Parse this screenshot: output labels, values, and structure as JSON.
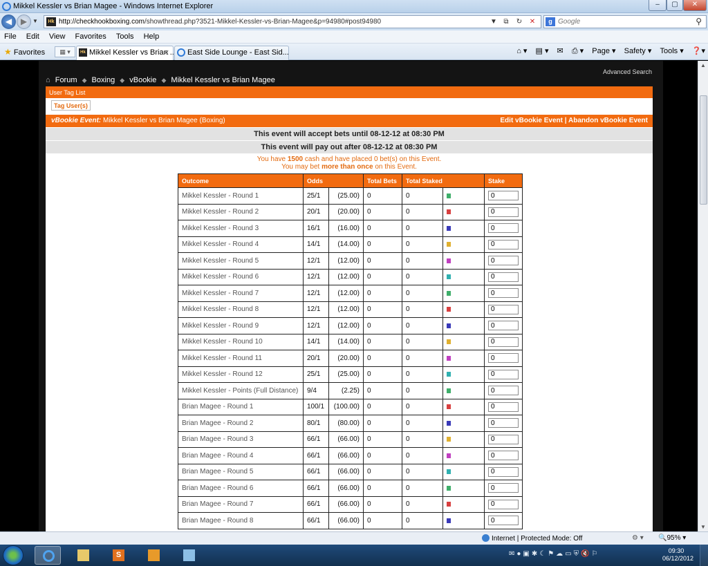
{
  "window": {
    "title": "Mikkel Kessler vs Brian Magee - Windows Internet Explorer",
    "minimize": "–",
    "maximize": "▢",
    "close": "✕"
  },
  "address": {
    "url_host": "http://checkhookboxing.com",
    "url_path": "/showthread.php?3521-Mikkel-Kessler-vs-Brian-Magee&p=94980#post94980",
    "favicon_text": "Hk"
  },
  "search": {
    "placeholder": "Google",
    "g_icon": "g"
  },
  "menu": [
    "File",
    "Edit",
    "View",
    "Favorites",
    "Tools",
    "Help"
  ],
  "favorites_label": "Favorites",
  "tabs": [
    {
      "title": "Mikkel Kessler vs Brian ...",
      "active": true
    },
    {
      "title": "East Side Lounge - East Sid...",
      "active": false
    }
  ],
  "commands": [
    "Page ▾",
    "Safety ▾",
    "Tools ▾"
  ],
  "page": {
    "advanced_search": "Advanced Search",
    "breadcrumb": [
      "Forum",
      "Boxing",
      "vBookie",
      "Mikkel Kessler vs Brian Magee"
    ],
    "user_tag_list": "User Tag List",
    "tag_users_button": "Tag User(s)",
    "event_label": "vBookie Event:",
    "event_name": "Mikkel Kessler vs Brian Magee (Boxing)",
    "edit_label": "Edit vBookie Event",
    "abandon_label": "Abandon vBookie Event",
    "separator": "|",
    "accept_until": "This event will accept bets until 08-12-12 at 08:30 PM",
    "pay_out_after": "This event will pay out after 08-12-12 at 08:30 PM",
    "note1_pre": "You have",
    "note1_cash": "1500",
    "note1_post": "cash and have placed 0 bet(s) on this Event.",
    "note2_pre": "You may bet",
    "note2_bold": "more than once",
    "note2_post": "on this Event."
  },
  "table": {
    "headers": {
      "outcome": "Outcome",
      "odds": "Odds",
      "total_bets": "Total Bets",
      "total_staked": "Total Staked",
      "stake": "Stake"
    },
    "rows": [
      {
        "outcome": "Mikkel Kessler - Round 1",
        "odds": "25/1",
        "decimal": "(25.00)",
        "bets": "0",
        "staked": "0",
        "color": "#3fae6a",
        "stake": "0"
      },
      {
        "outcome": "Mikkel Kessler - Round 2",
        "odds": "20/1",
        "decimal": "(20.00)",
        "bets": "0",
        "staked": "0",
        "color": "#d84040",
        "stake": "0"
      },
      {
        "outcome": "Mikkel Kessler - Round 3",
        "odds": "16/1",
        "decimal": "(16.00)",
        "bets": "0",
        "staked": "0",
        "color": "#3a3ab8",
        "stake": "0"
      },
      {
        "outcome": "Mikkel Kessler - Round 4",
        "odds": "14/1",
        "decimal": "(14.00)",
        "bets": "0",
        "staked": "0",
        "color": "#e0b030",
        "stake": "0"
      },
      {
        "outcome": "Mikkel Kessler - Round 5",
        "odds": "12/1",
        "decimal": "(12.00)",
        "bets": "0",
        "staked": "0",
        "color": "#c040c0",
        "stake": "0"
      },
      {
        "outcome": "Mikkel Kessler - Round 6",
        "odds": "12/1",
        "decimal": "(12.00)",
        "bets": "0",
        "staked": "0",
        "color": "#30b0b0",
        "stake": "0"
      },
      {
        "outcome": "Mikkel Kessler - Round 7",
        "odds": "12/1",
        "decimal": "(12.00)",
        "bets": "0",
        "staked": "0",
        "color": "#3fae6a",
        "stake": "0"
      },
      {
        "outcome": "Mikkel Kessler - Round 8",
        "odds": "12/1",
        "decimal": "(12.00)",
        "bets": "0",
        "staked": "0",
        "color": "#d84040",
        "stake": "0"
      },
      {
        "outcome": "Mikkel Kessler - Round 9",
        "odds": "12/1",
        "decimal": "(12.00)",
        "bets": "0",
        "staked": "0",
        "color": "#3a3ab8",
        "stake": "0"
      },
      {
        "outcome": "Mikkel Kessler - Round 10",
        "odds": "14/1",
        "decimal": "(14.00)",
        "bets": "0",
        "staked": "0",
        "color": "#e0b030",
        "stake": "0"
      },
      {
        "outcome": "Mikkel Kessler - Round 11",
        "odds": "20/1",
        "decimal": "(20.00)",
        "bets": "0",
        "staked": "0",
        "color": "#c040c0",
        "stake": "0"
      },
      {
        "outcome": "Mikkel Kessler - Round 12",
        "odds": "25/1",
        "decimal": "(25.00)",
        "bets": "0",
        "staked": "0",
        "color": "#30b0b0",
        "stake": "0"
      },
      {
        "outcome": "Mikkel Kessler - Points (Full Distance)",
        "odds": "9/4",
        "decimal": "(2.25)",
        "bets": "0",
        "staked": "0",
        "color": "#3fae6a",
        "stake": "0"
      },
      {
        "outcome": "Brian Magee - Round 1",
        "odds": "100/1",
        "decimal": "(100.00)",
        "bets": "0",
        "staked": "0",
        "color": "#d84040",
        "stake": "0"
      },
      {
        "outcome": "Brian Magee - Round 2",
        "odds": "80/1",
        "decimal": "(80.00)",
        "bets": "0",
        "staked": "0",
        "color": "#3a3ab8",
        "stake": "0"
      },
      {
        "outcome": "Brian Magee - Round 3",
        "odds": "66/1",
        "decimal": "(66.00)",
        "bets": "0",
        "staked": "0",
        "color": "#e0b030",
        "stake": "0"
      },
      {
        "outcome": "Brian Magee - Round 4",
        "odds": "66/1",
        "decimal": "(66.00)",
        "bets": "0",
        "staked": "0",
        "color": "#c040c0",
        "stake": "0"
      },
      {
        "outcome": "Brian Magee - Round 5",
        "odds": "66/1",
        "decimal": "(66.00)",
        "bets": "0",
        "staked": "0",
        "color": "#30b0b0",
        "stake": "0"
      },
      {
        "outcome": "Brian Magee - Round 6",
        "odds": "66/1",
        "decimal": "(66.00)",
        "bets": "0",
        "staked": "0",
        "color": "#3fae6a",
        "stake": "0"
      },
      {
        "outcome": "Brian Magee - Round 7",
        "odds": "66/1",
        "decimal": "(66.00)",
        "bets": "0",
        "staked": "0",
        "color": "#d84040",
        "stake": "0"
      },
      {
        "outcome": "Brian Magee - Round 8",
        "odds": "66/1",
        "decimal": "(66.00)",
        "bets": "0",
        "staked": "0",
        "color": "#3a3ab8",
        "stake": "0"
      }
    ]
  },
  "status": {
    "zone": "Internet | Protected Mode: Off",
    "zoom": "95%"
  },
  "taskbar": {
    "ppt_letter": "S",
    "time": "09:30",
    "date": "06/12/2012"
  }
}
